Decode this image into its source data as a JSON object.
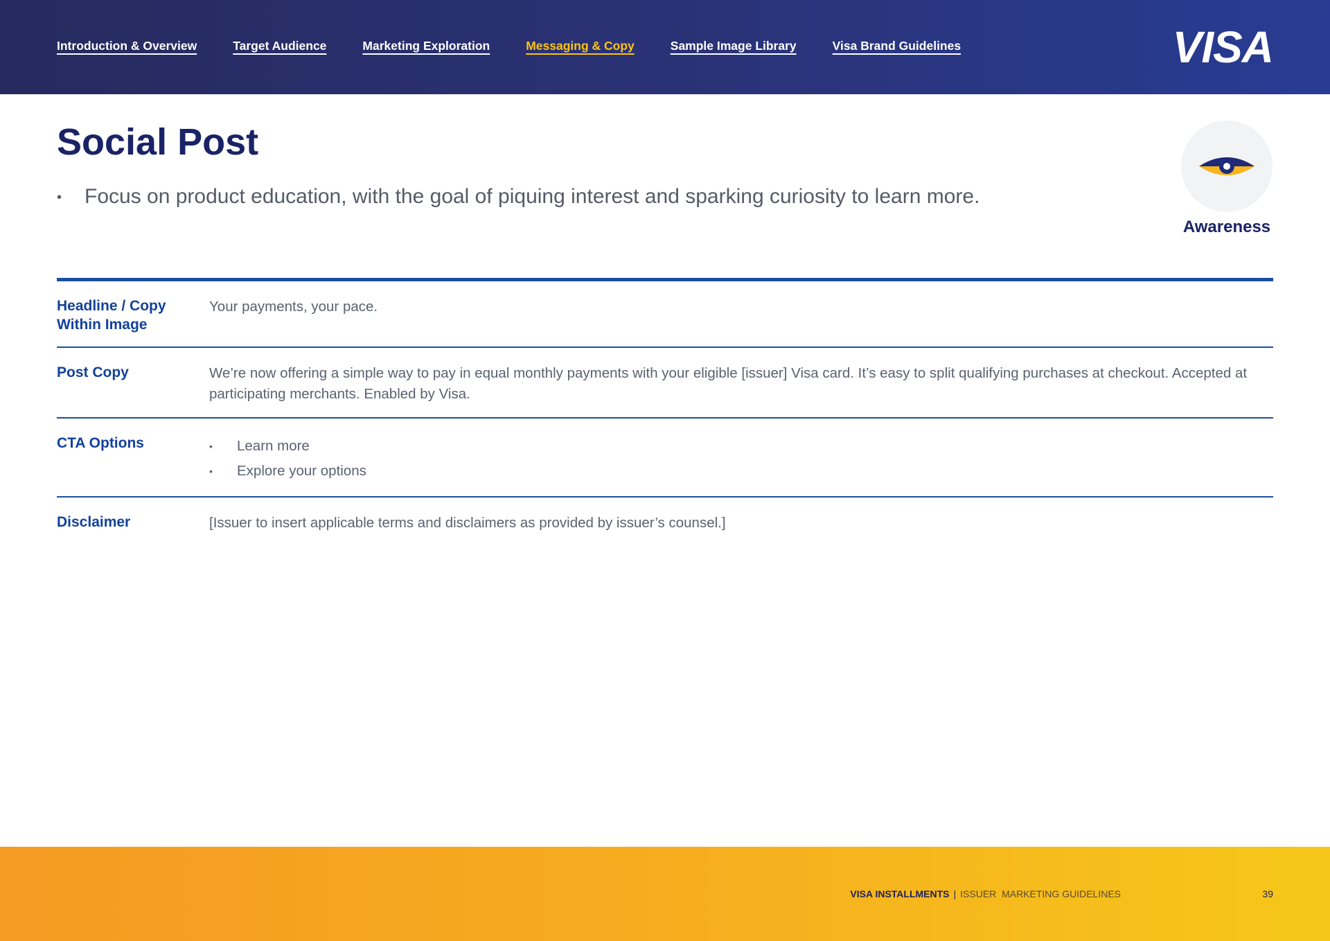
{
  "nav": {
    "items": [
      {
        "label": "Introduction & Overview"
      },
      {
        "label": "Target Audience"
      },
      {
        "label": "Marketing Exploration"
      },
      {
        "label": "Messaging & Copy",
        "active": true
      },
      {
        "label": "Sample Image Library"
      },
      {
        "label": "Visa Brand Guidelines"
      }
    ],
    "logo": "VISA",
    "active_color": "#fcc419"
  },
  "page": {
    "title": "Social Post",
    "intro_bullet": "Focus on product education, with the goal of piquing interest and sparking curiosity to learn more."
  },
  "stage": {
    "icon": "eye-icon",
    "label": "Awareness"
  },
  "table": {
    "headline_label": "Headline / Copy Within Image",
    "headline_value": "Your payments, your pace.",
    "post_copy_label": "Post Copy",
    "post_copy_value": "We’re now offering a simple way to pay in equal monthly payments with your eligible [issuer] Visa card. It’s easy to split qualifying purchases at checkout. Accepted at participating merchants. Enabled by Visa.",
    "cta_label": "CTA Options",
    "cta_items": [
      "Learn more",
      "Explore your options"
    ],
    "disclaimer_label": "Disclaimer",
    "disclaimer_value": "[Issuer to insert applicable terms and disclaimers as provided by issuer’s counsel.]"
  },
  "footer": {
    "brand": "VISA INSTALLMENTS",
    "separator": "|",
    "doc_title": "ISSUER  MARKETING GUIDELINES",
    "page_number": "39"
  },
  "colors": {
    "header_navy": "#262a5e",
    "title_navy": "#1a2366",
    "label_blue": "#13419a",
    "rule_blue": "#1a4fa0",
    "footer_orange": "#f59a23",
    "footer_yellow": "#f6c71a"
  }
}
